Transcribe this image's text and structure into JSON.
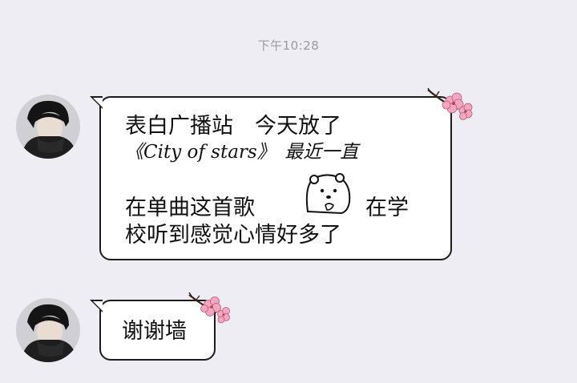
{
  "timestamp": "下午10:28",
  "messages": [
    {
      "lines": [
        "表白广播站　今天放了",
        "《City of stars》　最近一直",
        "在单曲这首歌",
        "在学",
        "校听到感觉心情好多了"
      ],
      "sticker": "polar-bear-emoji"
    },
    {
      "lines": [
        "谢谢墙"
      ]
    }
  ],
  "colors": {
    "background": "#ededf3",
    "bubble_border": "#1c1c1c",
    "flower_pink": "#f2a7bf",
    "timestamp": "#9a9aa2"
  }
}
